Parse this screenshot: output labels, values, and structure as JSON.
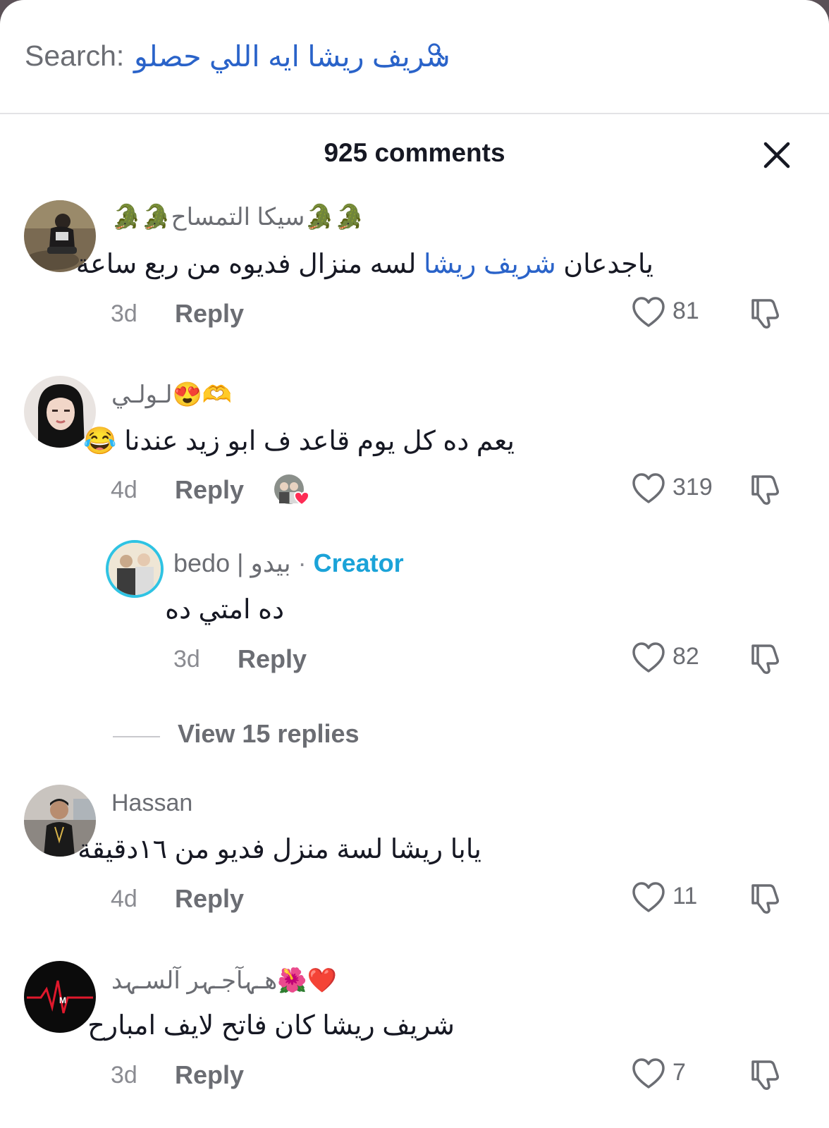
{
  "search": {
    "label": "Search:",
    "query": "شريف ريشا ايه اللي حصلو"
  },
  "header": {
    "title": "925 comments"
  },
  "comments": [
    {
      "username": "🐊🐊سيكا التمساح🐊🐊",
      "text_before_link": "ياجدعان ",
      "link": "شريف ريشا",
      "text_after_link": " لسه منزال فديوه من ربع ساعة",
      "time": "3d",
      "reply": "Reply",
      "likes": "81"
    },
    {
      "username": "لـولـي😍🫶",
      "text": "يعم ده كل يوم قاعد ف ابو زيد عندنا 😂",
      "time": "4d",
      "reply": "Reply",
      "likes": "319"
    },
    {
      "username": "Hassan",
      "text": "يابا ريشا لسة منزل فديو من ١٦دقيقة",
      "time": "4d",
      "reply": "Reply",
      "likes": "11"
    },
    {
      "username": "هـہآجـہر آلسـہد🌺❤️",
      "text": "شريف ريشا كان فاتح لايف امبارح",
      "time": "3d",
      "reply": "Reply",
      "likes": "7"
    }
  ],
  "creator_reply": {
    "username": "bedo | بيدو",
    "separator": " · ",
    "badge": "Creator",
    "text": "ده امتي ده",
    "time": "3d",
    "reply": "Reply",
    "likes": "82"
  },
  "view_replies": {
    "label": "View 15 replies"
  },
  "colors": {
    "link": "#2a63c9",
    "creator": "#1ba3d8",
    "liked_heart": "#fe2c55",
    "muted_text": "#6b6d73"
  }
}
